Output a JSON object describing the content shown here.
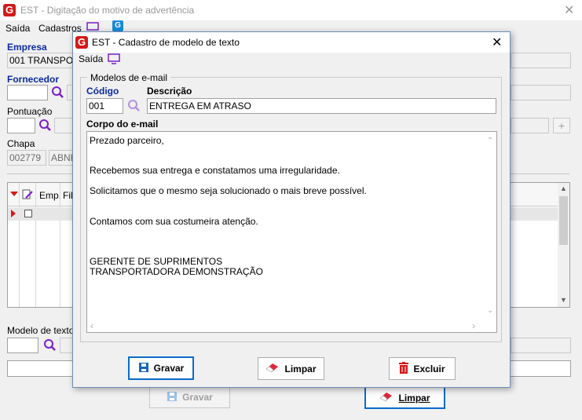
{
  "main_window": {
    "title": "EST - Digitação do motivo de advertência",
    "menu": {
      "exit": "Saída",
      "registers": "Cadastros"
    },
    "company": {
      "label": "Empresa",
      "value": "001 TRANSPOR"
    },
    "supplier": {
      "label": "Fornecedor",
      "value": ""
    },
    "score": {
      "label": "Pontuação",
      "value": ""
    },
    "plate": {
      "label": "Chapa",
      "code": "002779",
      "name": "ABNE"
    },
    "grid": {
      "columns": [
        "Emp.",
        "Fil."
      ]
    },
    "text_model": {
      "label": "Modelo de texto",
      "value": ""
    },
    "buttons": {
      "save": "Gravar",
      "clear": "Limpar"
    }
  },
  "dialog": {
    "title": "EST - Cadastro de modelo de texto",
    "menu": {
      "exit": "Saída"
    },
    "group_label": "Modelos de e-mail",
    "code_label": "Código",
    "code_value": "001",
    "description_label": "Descrição",
    "description_value": "ENTREGA EM ATRASO",
    "body_label": "Corpo do e-mail",
    "body_lines": [
      "Prezado parceiro,",
      "",
      "Recebemos sua entrega e constatamos uma irregularidade.",
      "",
      "Solicitamos que o mesmo seja solucionado o mais breve possível.",
      "",
      "",
      "Contamos com sua costumeira atenção.",
      "",
      "",
      "GERENTE DE SUPRIMENTOS",
      "TRANSPORTADORA DEMONSTRAÇÃO"
    ],
    "buttons": {
      "save": "Gravar",
      "clear": "Limpar",
      "delete": "Excluir"
    }
  },
  "colors": {
    "logo": "#d11a1a",
    "label_blue": "#0a2aa0",
    "search_icon": "#7a1fc9",
    "primary_border": "#0a6cc9"
  }
}
